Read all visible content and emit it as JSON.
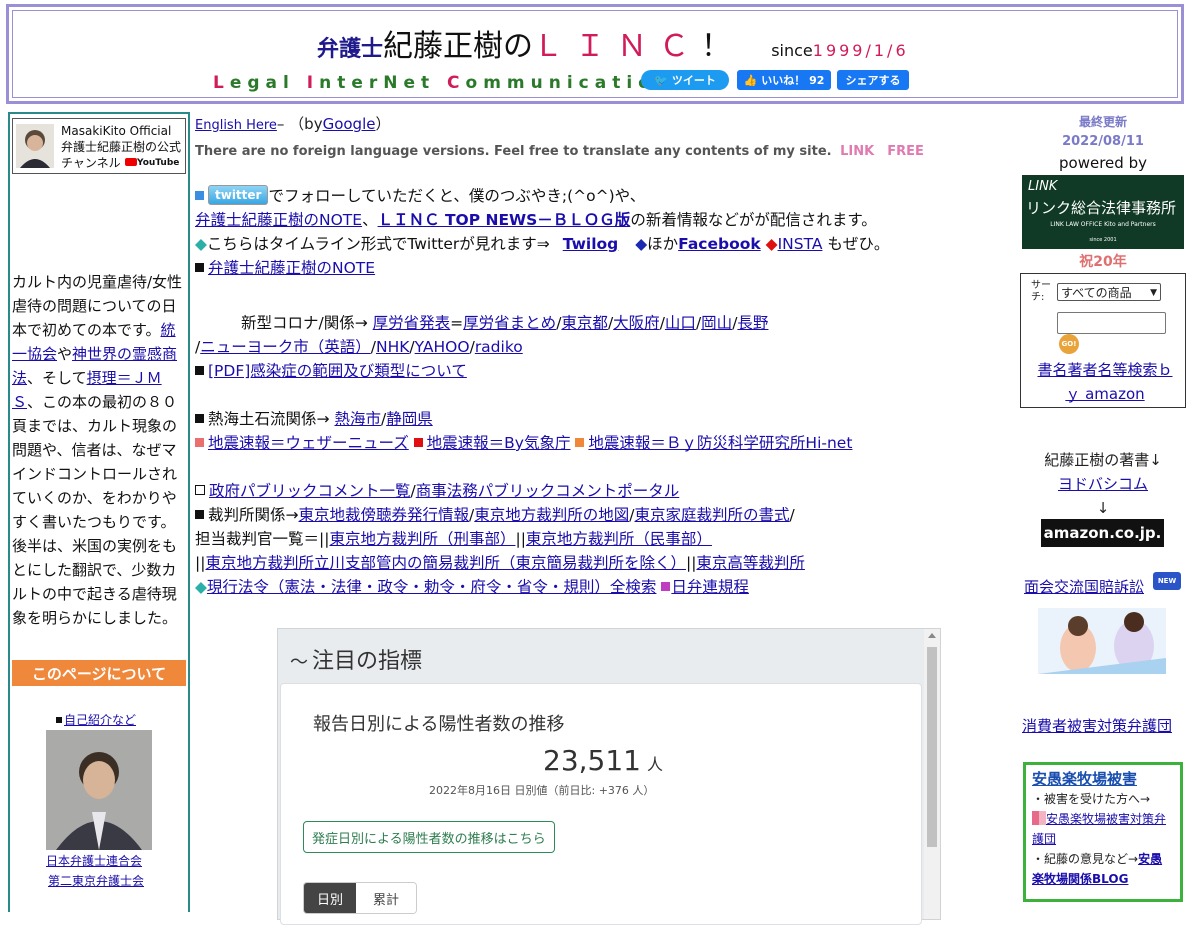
{
  "header": {
    "prefix": "弁護士",
    "title_main": "紀藤正樹の",
    "title_linc": "ＬＩＮＣ",
    "exclaim": "！",
    "since_label": "since",
    "since_date": "1999/1/6",
    "tagline_parts": [
      {
        "cap": "L",
        "rest": "egal "
      },
      {
        "cap": "I",
        "rest": "nterNet "
      },
      {
        "cap": "C",
        "rest": "ommunication"
      }
    ],
    "tweet_label": "ツイート",
    "like_label": "いいね！ 92",
    "share_label": "シェアする"
  },
  "left": {
    "channel_text": "MasakiKito Official 弁護士紀藤正樹の公式チャンネル",
    "youtube_label": "YouTube",
    "book_text_1": "カルト内の児童虐待/女性虐待の問題についての日本で初めての本です。",
    "link_unification": "統一協会",
    "text_ya": "や",
    "link_shinsekai": "神世界の霊感商法",
    "text_soshite": "、そして",
    "link_setsuri": "摂理＝ＪＭＳ",
    "book_text_2": "、この本の最初の８０頁までは、カルト現象の問題や、信者は、なぜマインドコントロールされていくのか、をわかりやすく書いたつもりです。後半は、米国の実例をもとにした翻訳で、少数カルトの中で起きる虐待現象を明らかにしました。",
    "about_button": "このページについて",
    "self_intro_link": "自己紹介など",
    "assoc1": "日本弁護士連合会",
    "assoc2": "第二東京弁護士会"
  },
  "middle": {
    "english_link": "English Here",
    "english_dash": "– （by",
    "google_link": "Google",
    "english_close": "）",
    "no_foreign": "There are no foreign language versions. Feel free to translate any contents of my site.",
    "link_free": "LINK　FREE",
    "twitter_badge": "twitter",
    "follow_text": "でフォローしていただくと、僕のつぶやき;(^o^)や、",
    "note_link": "弁護士紀藤正樹のNOTE",
    "comma": "、",
    "top_news_link": "ＬＩＮＣ TOP NEWS－ＢＬＯＧ版",
    "follow_text_2": "の新着情報などがが配信されます。",
    "timeline_text": "こちらはタイムライン形式でTwitterが見れます⇒",
    "twilog_link": "Twilog",
    "hoka_text": "ほか",
    "facebook_link": "Facebook",
    "insta_link": "INSTA",
    "zehi_text": "もぜひ。",
    "note_link_2": "弁護士紀藤正樹のNOTE",
    "corona_label": "新型コロナ/関係→",
    "corona_links": [
      "厚労省発表",
      "厚労省まとめ",
      "東京都",
      "大阪府",
      "山口",
      "岡山",
      "長野",
      "ニューヨーク市（英語）",
      "NHK",
      "YAHOO",
      "radiko"
    ],
    "pdf_link": "[PDF]感染症の範囲及び類型について",
    "atami_label": "熱海土石流関係→",
    "atami_links": [
      "熱海市",
      "静岡県"
    ],
    "quake_links": [
      "地震速報＝ウェザーニューズ",
      "地震速報＝By気象庁",
      "地震速報＝Ｂｙ防災科学研究所Hi-net"
    ],
    "public_comment_links": [
      "政府パブリックコメント一覧",
      "商事法務パブリックコメントポータル"
    ],
    "court_label": "裁判所関係→",
    "court_links": [
      "東京地裁傍聴券発行情報",
      "東京地方裁判所の地図",
      "東京家庭裁判所の書式"
    ],
    "judge_label": "担当裁判官一覧＝||",
    "judge_links": [
      "東京地方裁判所（刑事部）",
      "東京地方裁判所（民事部）",
      "東京地方裁判所立川支部管内の簡易裁判所（東京簡易裁判所を除く）",
      "東京高等裁判所"
    ],
    "law_link": "現行法令（憲法・法律・政令・勅令・府令・省令・規則）全検索",
    "nichibenren_link": "日弁連規程"
  },
  "widget": {
    "header": "注目の指標",
    "card_title": "報告日別による陽性者数の推移",
    "count": "23,511",
    "unit": "人",
    "date_note": "2022年8月16日 日別値（前日比: +376 人）",
    "onset_button": "発症日別による陽性者数の推移はこちら",
    "tab_daily": "日別",
    "tab_total": "累計"
  },
  "right": {
    "updated_label": "最終更新",
    "updated_date": "2022/08/11",
    "powered_by": "powered by",
    "firm_logo_top": "LINK",
    "firm_logo_name": "リンク総合法律事務所",
    "firm_logo_sub": "LINK LAW OFFICE  Kito and Partners",
    "firm_logo_since": "since 2001",
    "anniversary": "祝20年",
    "search_label": "サーチ:",
    "search_select": "すべての商品",
    "search_go": "GO!",
    "search_link": "書名著者名等検索ｂｙ amazon",
    "books_label": "紀藤正樹の著書↓",
    "yodobashi_link": "ヨドバシコム",
    "arrow": "↓",
    "amazon_logo": "amazon.co.jp.",
    "kokusai_link": "面会交流国賠訴訟",
    "new_badge": "NEW",
    "consumer_link": "消費者被害対策弁護団",
    "ajimu_title": "安愚楽牧場被害",
    "ajimu_line1": "・被害を受けた方へ→",
    "ajimu_link1": "安愚楽牧場被害対策弁護団",
    "ajimu_line2": "・紀藤の意見など→",
    "ajimu_link2": "安愚楽牧場関係BLOG"
  },
  "colors": {
    "linc_red": "#d01c5b",
    "header_border": "#9b8fd6",
    "left_border": "#2a8a8a",
    "about_orange": "#f0883c",
    "ajimu_green": "#3cb13c"
  }
}
